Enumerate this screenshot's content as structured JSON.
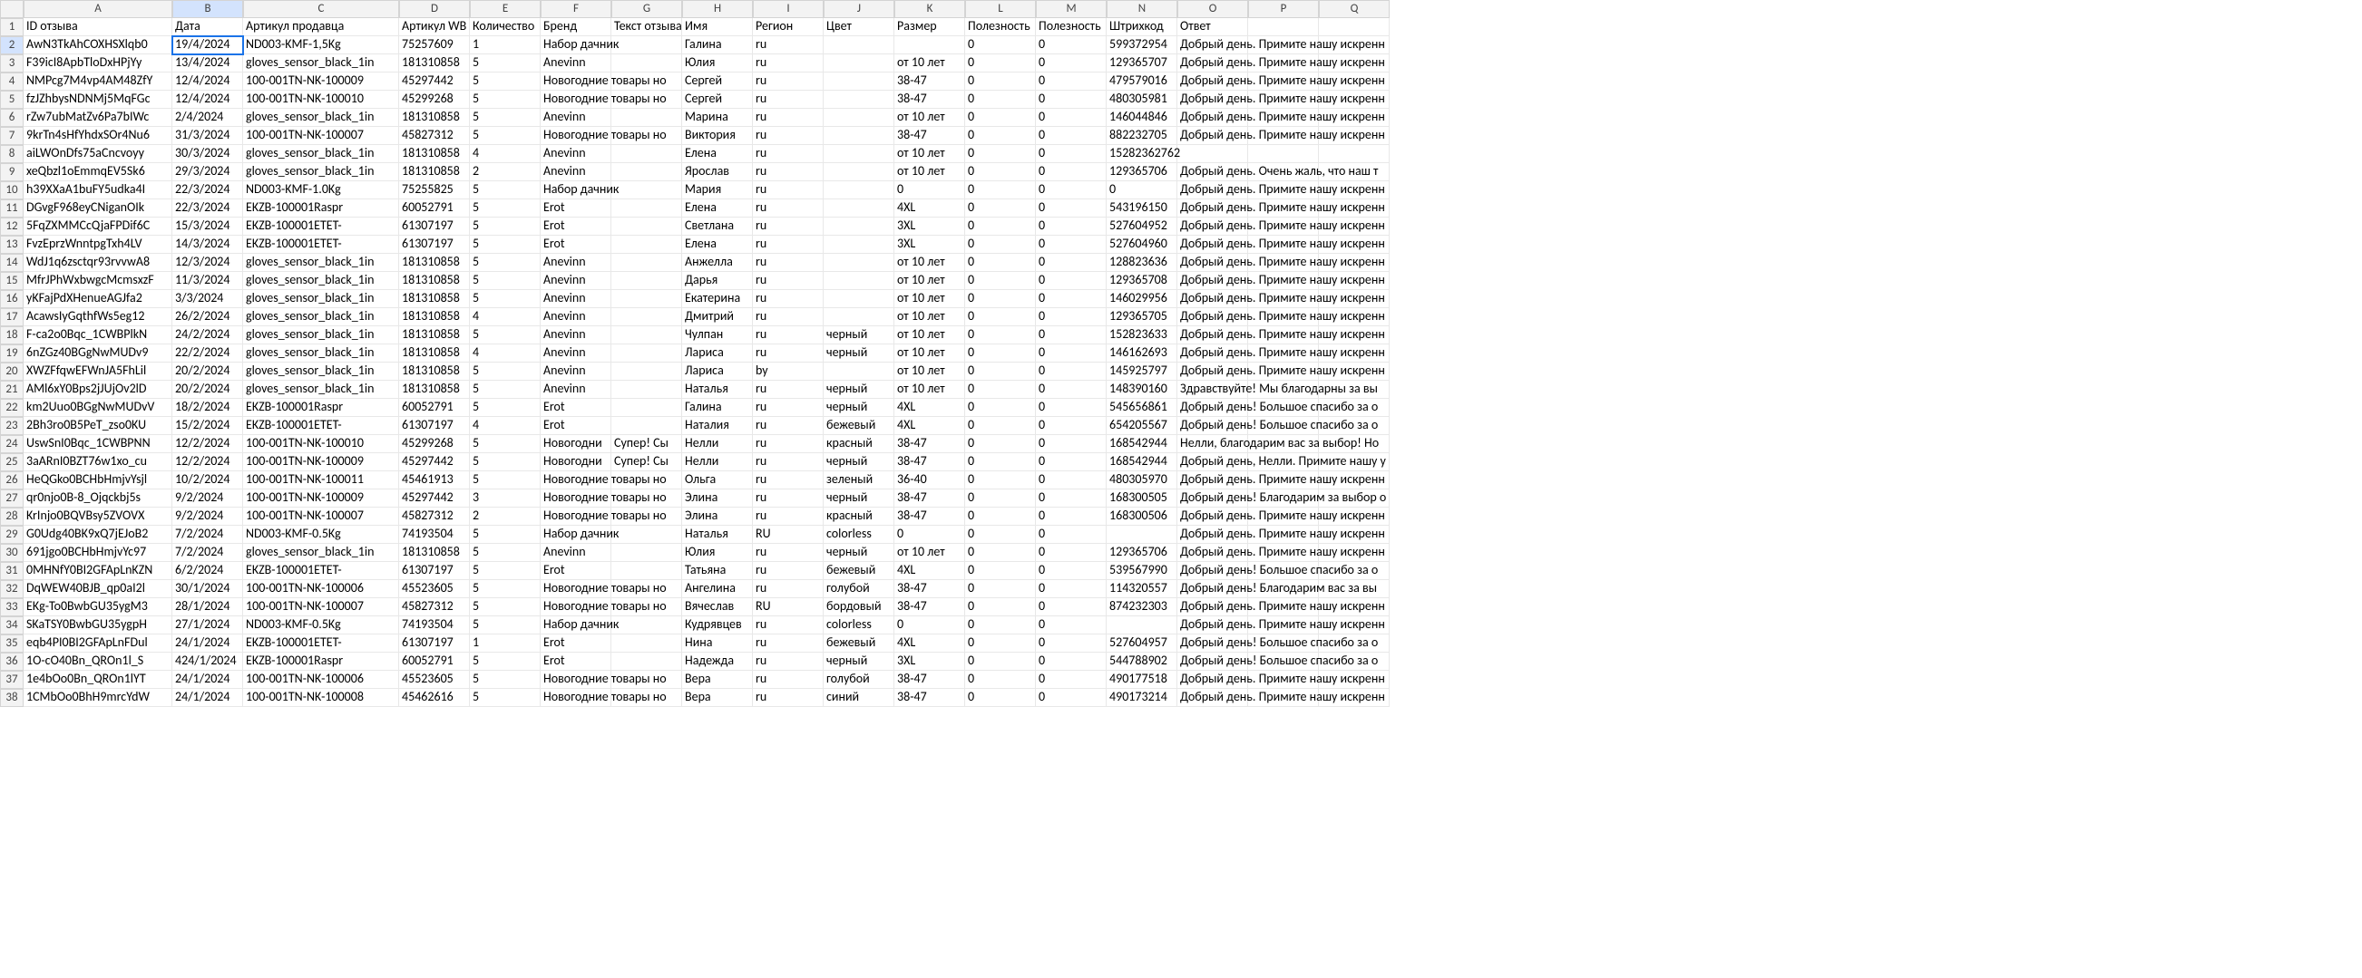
{
  "columns": [
    "A",
    "B",
    "C",
    "D",
    "E",
    "F",
    "G",
    "H",
    "I",
    "J",
    "K",
    "L",
    "M",
    "N",
    "O",
    "P",
    "Q"
  ],
  "headers": [
    "ID отзыва",
    "Дата",
    "Артикул продавца",
    "Артикул WB",
    "Количество",
    "Бренд",
    "Текст отзыва",
    "Имя",
    "Регион",
    "Цвет",
    "Размер",
    "Полезность",
    "Полезность",
    "Штрихкод",
    "Ответ",
    "",
    ""
  ],
  "selected_cell": {
    "row": 2,
    "col": "B"
  },
  "rows": [
    {
      "n": 2,
      "cells": [
        "AwN3TkAhCOXHSXlqb0",
        "19/4/2024",
        "ND003-KMF-1,5Kg",
        "75257609",
        "1",
        "Набор дачник",
        "",
        "Галина",
        "ru",
        "",
        "",
        "0",
        "0",
        "599372954",
        "Добрый день. Примите нашу искренн",
        "",
        ""
      ]
    },
    {
      "n": 3,
      "cells": [
        "F39icI8ApbTloDxHPjYy",
        "13/4/2024",
        "gloves_sensor_black_1in",
        "181310858",
        "5",
        "Anevinn",
        "",
        "Юлия",
        "ru",
        "",
        "от 10 лет",
        "0",
        "0",
        "129365707",
        "Добрый день. Примите нашу искренн",
        "",
        ""
      ]
    },
    {
      "n": 4,
      "cells": [
        "NMPcg7M4vp4AM48ZfY",
        "12/4/2024",
        "100-001TN-NK-100009",
        "45297442",
        "5",
        "Новогодние товары но",
        "",
        "Сергей",
        "ru",
        "",
        "38-47",
        "0",
        "0",
        "479579016",
        "Добрый день. Примите нашу искренн",
        "",
        ""
      ]
    },
    {
      "n": 5,
      "cells": [
        "fzJZhbysNDNMj5MqFGc",
        "12/4/2024",
        "100-001TN-NK-100010",
        "45299268",
        "5",
        "Новогодние товары но",
        "",
        "Сергей",
        "ru",
        "",
        "38-47",
        "0",
        "0",
        "480305981",
        "Добрый день. Примите нашу искренн",
        "",
        ""
      ]
    },
    {
      "n": 6,
      "cells": [
        "rZw7ubMatZv6Pa7bIWc",
        "2/4/2024",
        "gloves_sensor_black_1in",
        "181310858",
        "5",
        "Anevinn",
        "",
        "Марина",
        "ru",
        "",
        "от 10 лет",
        "0",
        "0",
        "146044846",
        "Добрый день. Примите нашу искренн",
        "",
        ""
      ]
    },
    {
      "n": 7,
      "cells": [
        "9krTn4sHfYhdxSOr4Nu6",
        "31/3/2024",
        "100-001TN-NK-100007",
        "45827312",
        "5",
        "Новогодние товары но",
        "",
        "Виктория",
        "ru",
        "",
        "38-47",
        "0",
        "0",
        "882232705",
        "Добрый день. Примите нашу искренн",
        "",
        ""
      ]
    },
    {
      "n": 8,
      "cells": [
        "aiLWOnDfs75aCncvoyy",
        "30/3/2024",
        "gloves_sensor_black_1in",
        "181310858",
        "4",
        "Anevinn",
        "",
        "Елена",
        "ru",
        "",
        "от 10 лет",
        "0",
        "0",
        "15282362762",
        "",
        "",
        ""
      ]
    },
    {
      "n": 9,
      "cells": [
        "xeQbzl1oEmmqEV5Sk6",
        "29/3/2024",
        "gloves_sensor_black_1in",
        "181310858",
        "2",
        "Anevinn",
        "",
        "Ярослав",
        "ru",
        "",
        "от 10 лет",
        "0",
        "0",
        "129365706",
        "Добрый день. Очень жаль, что наш т",
        "",
        ""
      ]
    },
    {
      "n": 10,
      "cells": [
        "h39XXaA1buFY5udka4I",
        "22/3/2024",
        "ND003-KMF-1.0Kg",
        "75255825",
        "5",
        "Набор дачник",
        "",
        "Мария",
        "ru",
        "",
        "0",
        "0",
        "0",
        "0",
        "Добрый день. Примите нашу искренн",
        "",
        ""
      ]
    },
    {
      "n": 11,
      "cells": [
        "DGvgF968eyCNiganOIk",
        "22/3/2024",
        "EKZB-100001Raspr",
        "60052791",
        "5",
        "Erot",
        "",
        "Елена",
        "ru",
        "",
        "4XL",
        "0",
        "0",
        "543196150",
        "Добрый день. Примите нашу искренн",
        "",
        ""
      ]
    },
    {
      "n": 12,
      "cells": [
        "5FqZXMMCcQjaFPDif6C",
        "15/3/2024",
        "EKZB-100001ETET-",
        "61307197",
        "5",
        "Erot",
        "",
        "Светлана",
        "ru",
        "",
        "3XL",
        "0",
        "0",
        "527604952",
        "Добрый день. Примите нашу искренн",
        "",
        ""
      ]
    },
    {
      "n": 13,
      "cells": [
        "FvzEprzWnntpgTxh4LV",
        "14/3/2024",
        "EKZB-100001ETET-",
        "61307197",
        "5",
        "Erot",
        "",
        "Елена",
        "ru",
        "",
        "3XL",
        "0",
        "0",
        "527604960",
        "Добрый день. Примите нашу искренн",
        "",
        ""
      ]
    },
    {
      "n": 14,
      "cells": [
        "WdJ1q6zsctqr93rvvwA8",
        "12/3/2024",
        "gloves_sensor_black_1in",
        "181310858",
        "5",
        "Anevinn",
        "",
        "Анжелла",
        "ru",
        "",
        "от 10 лет",
        "0",
        "0",
        "128823636",
        "Добрый день. Примите нашу искренн",
        "",
        ""
      ]
    },
    {
      "n": 15,
      "cells": [
        "MfrJPhWxbwgcMcmsxzF",
        "11/3/2024",
        "gloves_sensor_black_1in",
        "181310858",
        "5",
        "Anevinn",
        "",
        "Дарья",
        "ru",
        "",
        "от 10 лет",
        "0",
        "0",
        "129365708",
        "Добрый день. Примите нашу искренн",
        "",
        ""
      ]
    },
    {
      "n": 16,
      "cells": [
        "yKFajPdXHenueAGJfa2",
        "3/3/2024",
        "gloves_sensor_black_1in",
        "181310858",
        "5",
        "Anevinn",
        "",
        "Екатерина",
        "ru",
        "",
        "от 10 лет",
        "0",
        "0",
        "146029956",
        "Добрый день. Примите нашу искренн",
        "",
        ""
      ]
    },
    {
      "n": 17,
      "cells": [
        "AcawsIyGqthfWs5eg12",
        "26/2/2024",
        "gloves_sensor_black_1in",
        "181310858",
        "4",
        "Anevinn",
        "",
        "Дмитрий",
        "ru",
        "",
        "от 10 лет",
        "0",
        "0",
        "129365705",
        "Добрый день. Примите нашу искренн",
        "",
        ""
      ]
    },
    {
      "n": 18,
      "cells": [
        "F-ca2o0Bqc_1CWBPlkN",
        "24/2/2024",
        "gloves_sensor_black_1in",
        "181310858",
        "5",
        "Anevinn",
        "",
        "Чулпан",
        "ru",
        "черный",
        "от 10 лет",
        "0",
        "0",
        "152823633",
        "Добрый день. Примите нашу искренн",
        "",
        ""
      ]
    },
    {
      "n": 19,
      "cells": [
        "6nZGz40BGgNwMUDv9",
        "22/2/2024",
        "gloves_sensor_black_1in",
        "181310858",
        "4",
        "Anevinn",
        "",
        "Лариса",
        "ru",
        "черный",
        "от 10 лет",
        "0",
        "0",
        "146162693",
        "Добрый день. Примите нашу искренн",
        "",
        ""
      ]
    },
    {
      "n": 20,
      "cells": [
        "XWZFfqwEFWnJA5FhLil",
        "20/2/2024",
        "gloves_sensor_black_1in",
        "181310858",
        "5",
        "Anevinn",
        "",
        "Лариса",
        "by",
        "",
        "от 10 лет",
        "0",
        "0",
        "145925797",
        "Добрый день. Примите нашу искренн",
        "",
        ""
      ]
    },
    {
      "n": 21,
      "cells": [
        "AMl6xY0Bps2jJUjOv2lD",
        "20/2/2024",
        "gloves_sensor_black_1in",
        "181310858",
        "5",
        "Anevinn",
        "",
        "Наталья",
        "ru",
        "черный",
        "от 10 лет",
        "0",
        "0",
        "148390160",
        "Здравствуйте! Мы благодарны за вы",
        "",
        ""
      ]
    },
    {
      "n": 22,
      "cells": [
        "km2Uuo0BGgNwMUDvV",
        "18/2/2024",
        "EKZB-100001Raspr",
        "60052791",
        "5",
        "Erot",
        "",
        "Галина",
        "ru",
        "черный",
        "4XL",
        "0",
        "0",
        "545656861",
        "Добрый день! Большое спасибо за о",
        "",
        ""
      ]
    },
    {
      "n": 23,
      "cells": [
        "2Bh3ro0B5PeT_zso0KU",
        "15/2/2024",
        "EKZB-100001ETET-",
        "61307197",
        "4",
        "Erot",
        "",
        "Наталия",
        "ru",
        "бежевый",
        "4XL",
        "0",
        "0",
        "654205567",
        "Добрый день! Большое спасибо за о",
        "",
        ""
      ]
    },
    {
      "n": 24,
      "cells": [
        "UswSnI0Bqc_1CWBPNN",
        "12/2/2024",
        "100-001TN-NK-100010",
        "45299268",
        "5",
        "Новогодни",
        "Супер! Сы",
        "Нелли",
        "ru",
        "красный",
        "38-47",
        "0",
        "0",
        "168542944",
        "Нелли, благодарим вас за выбор! Но",
        "",
        ""
      ]
    },
    {
      "n": 25,
      "cells": [
        "3aARnI0BZT76w1xo_cu",
        "12/2/2024",
        "100-001TN-NK-100009",
        "45297442",
        "5",
        "Новогодни",
        "Супер! Сы",
        "Нелли",
        "ru",
        "черный",
        "38-47",
        "0",
        "0",
        "168542944",
        "Добрый день, Нелли. Примите нашу у",
        "",
        ""
      ]
    },
    {
      "n": 26,
      "cells": [
        "HeQGko0BCHbHmjvYsjl",
        "10/2/2024",
        "100-001TN-NK-100011",
        "45461913",
        "5",
        "Новогодние товары но",
        "",
        "Ольга",
        "ru",
        "зеленый",
        "36-40",
        "0",
        "0",
        "480305970",
        "Добрый день. Примите нашу искренн",
        "",
        ""
      ]
    },
    {
      "n": 27,
      "cells": [
        "qr0njo0B-8_Ojqckbj5s",
        "9/2/2024",
        "100-001TN-NK-100009",
        "45297442",
        "3",
        "Новогодние товары но",
        "",
        "Элина",
        "ru",
        "черный",
        "38-47",
        "0",
        "0",
        "168300505",
        "Добрый день! Благодарим за выбор о",
        "",
        ""
      ]
    },
    {
      "n": 28,
      "cells": [
        "KrInjo0BQVBsy5ZVOVX",
        "9/2/2024",
        "100-001TN-NK-100007",
        "45827312",
        "2",
        "Новогодние товары но",
        "",
        "Элина",
        "ru",
        "красный",
        "38-47",
        "0",
        "0",
        "168300506",
        "Добрый день. Примите нашу искренн",
        "",
        ""
      ]
    },
    {
      "n": 29,
      "cells": [
        "G0Udg40BK9xQ7jEJoB2",
        "7/2/2024",
        "ND003-KMF-0.5Kg",
        "74193504",
        "5",
        "Набор дачник",
        "",
        "Наталья",
        "RU",
        "colorless",
        "0",
        "0",
        "0",
        "",
        "Добрый день. Примите нашу искренн",
        "",
        ""
      ]
    },
    {
      "n": 30,
      "cells": [
        "691jgo0BCHbHmjvYc97",
        "7/2/2024",
        "gloves_sensor_black_1in",
        "181310858",
        "5",
        "Anevinn",
        "",
        "Юлия",
        "ru",
        "черный",
        "от 10 лет",
        "0",
        "0",
        "129365706",
        "Добрый день. Примите нашу искренн",
        "",
        ""
      ]
    },
    {
      "n": 31,
      "cells": [
        "0MHNfY0BI2GFApLnKZN",
        "6/2/2024",
        "EKZB-100001ETET-",
        "61307197",
        "5",
        "Erot",
        "",
        "Татьяна",
        "ru",
        "бежевый",
        "4XL",
        "0",
        "0",
        "539567990",
        "Добрый день! Большое спасибо за о",
        "",
        ""
      ]
    },
    {
      "n": 32,
      "cells": [
        "DqWEW40BJB_qp0aI2l",
        "30/1/2024",
        "100-001TN-NK-100006",
        "45523605",
        "5",
        "Новогодние товары но",
        "",
        "Ангелина",
        "ru",
        "голубой",
        "38-47",
        "0",
        "0",
        "114320557",
        "Добрый день! Благодарим вас за вы",
        "",
        ""
      ]
    },
    {
      "n": 33,
      "cells": [
        "EKg-To0BwbGU35ygM3",
        "28/1/2024",
        "100-001TN-NK-100007",
        "45827312",
        "5",
        "Новогодние товары но",
        "",
        "Вячеслав",
        "RU",
        "бордовый",
        "38-47",
        "0",
        "0",
        "874232303",
        "Добрый день. Примите нашу искренн",
        "",
        ""
      ]
    },
    {
      "n": 34,
      "cells": [
        "SKaTSY0BwbGU35ygpH",
        "27/1/2024",
        "ND003-KMF-0.5Kg",
        "74193504",
        "5",
        "Набор дачник",
        "",
        "Кудрявцев",
        "ru",
        "colorless",
        "0",
        "0",
        "0",
        "",
        "Добрый день. Примите нашу искренн",
        "",
        ""
      ]
    },
    {
      "n": 35,
      "cells": [
        "eqb4PI0BI2GFApLnFDul",
        "24/1/2024",
        "EKZB-100001ETET-",
        "61307197",
        "1",
        "Erot",
        "",
        "Нина",
        "ru",
        "бежевый",
        "4XL",
        "0",
        "0",
        "527604957",
        "Добрый день! Большое спасибо за о",
        "",
        ""
      ]
    },
    {
      "n": 36,
      "cells": [
        "1O-cO40Bn_QROn1l_S",
        "424/1/2024",
        "EKZB-100001Raspr",
        "60052791",
        "5",
        "Erot",
        "",
        "Надежда",
        "ru",
        "черный",
        "3XL",
        "0",
        "0",
        "544788902",
        "Добрый день! Большое спасибо за о",
        "",
        ""
      ]
    },
    {
      "n": 37,
      "cells": [
        "1e4bOo0Bn_QROn1lYT",
        "24/1/2024",
        "100-001TN-NK-100006",
        "45523605",
        "5",
        "Новогодние товары но",
        "",
        "Вера",
        "ru",
        "голубой",
        "38-47",
        "0",
        "0",
        "490177518",
        "Добрый день. Примите нашу искренн",
        "",
        ""
      ]
    },
    {
      "n": 38,
      "cells": [
        "1CMbOo0BhH9mrcYdW",
        "24/1/2024",
        "100-001TN-NK-100008",
        "45462616",
        "5",
        "Новогодние товары но",
        "",
        "Вера",
        "ru",
        "синий",
        "38-47",
        "0",
        "0",
        "490173214",
        "Добрый день. Примите нашу искренн",
        "",
        ""
      ]
    }
  ]
}
